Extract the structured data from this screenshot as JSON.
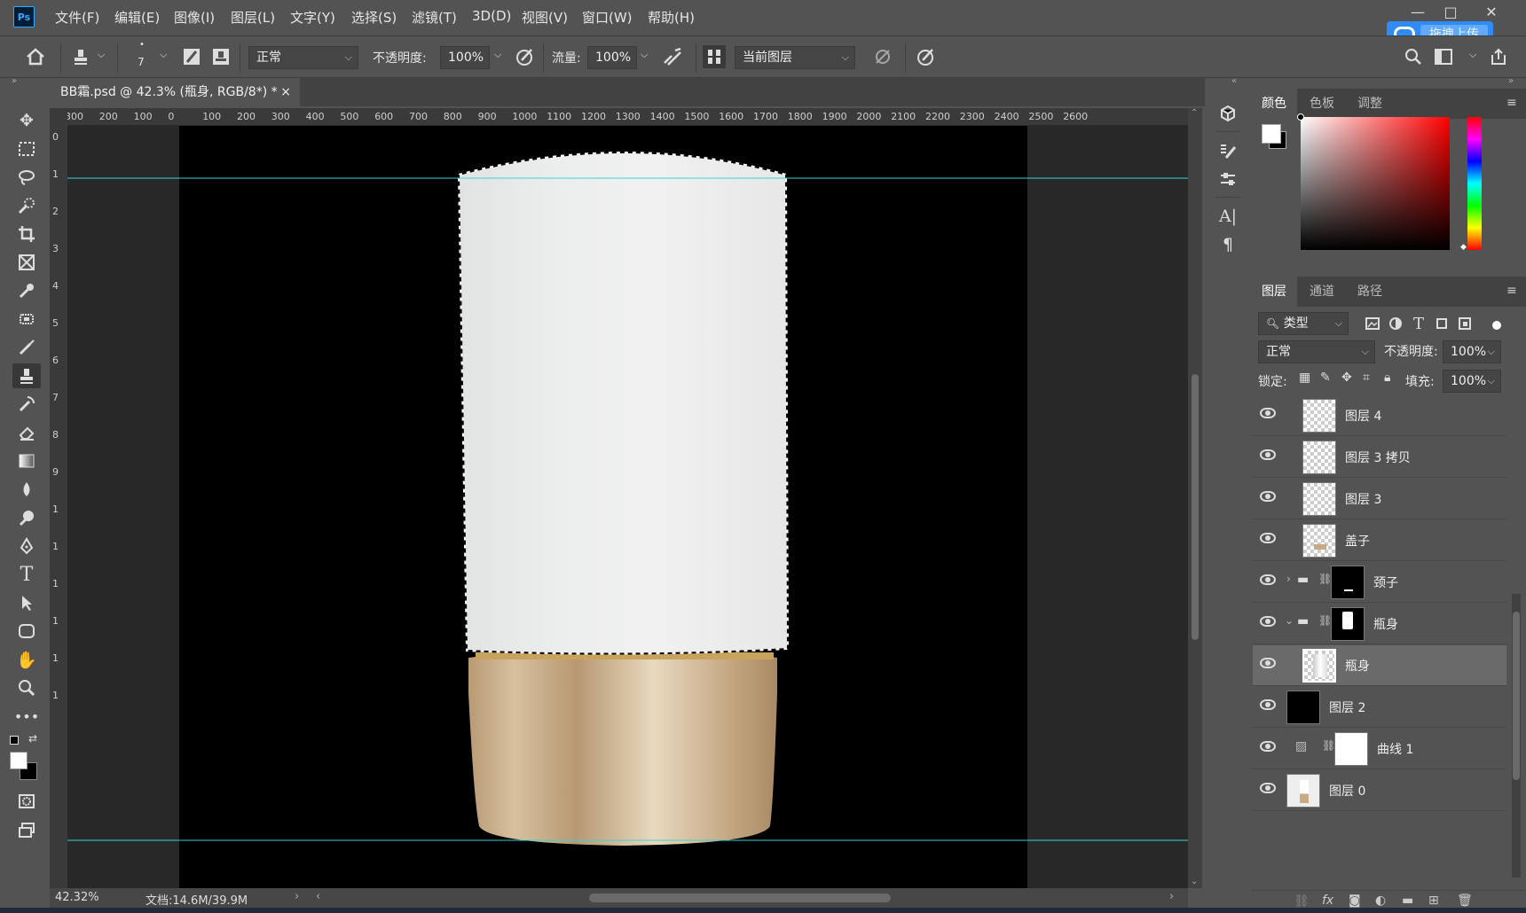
{
  "app": {
    "logo": "Ps",
    "upload_label": "拖拽上传"
  },
  "menu": [
    "文件(F)",
    "编辑(E)",
    "图像(I)",
    "图层(L)",
    "文字(Y)",
    "选择(S)",
    "滤镜(T)",
    "3D(D)",
    "视图(V)",
    "窗口(W)",
    "帮助(H)"
  ],
  "window_controls": {
    "minimize": "—",
    "maximize": "□",
    "close": "✕"
  },
  "options": {
    "brush_size": "7",
    "mode": "正常",
    "opacity_label": "不透明度:",
    "opacity_value": "100%",
    "flow_label": "流量:",
    "flow_value": "100%",
    "sample": "当前图层"
  },
  "document": {
    "tab_title": "BB霜.psd @ 42.3% (瓶身, RGB/8*) *",
    "close": "×",
    "zoom": "42.32%",
    "doc_info": "文档:14.6M/39.9M"
  },
  "ruler_h": [
    "300",
    "200",
    "100",
    "0",
    "100",
    "200",
    "300",
    "400",
    "500",
    "600",
    "700",
    "800",
    "900",
    "1000",
    "1100",
    "1200",
    "1300",
    "1400",
    "1500",
    "1600",
    "1700",
    "1800",
    "1900",
    "2000",
    "2100",
    "2200",
    "2300",
    "2400",
    "2500",
    "2600"
  ],
  "ruler_v": [
    "0",
    "1",
    "2",
    "3",
    "4",
    "5",
    "6",
    "7",
    "8",
    "9",
    "1",
    "1",
    "1",
    "1",
    "1",
    "1"
  ],
  "color_panel": {
    "tabs": [
      "颜色",
      "色板",
      "调整"
    ]
  },
  "layers_panel": {
    "tabs": [
      "图层",
      "通道",
      "路径"
    ],
    "filter": "类型",
    "blend_mode": "正常",
    "opacity_label": "不透明度:",
    "opacity_value": "100%",
    "lock_label": "锁定:",
    "fill_label": "填充:",
    "fill_value": "100%",
    "layers": [
      {
        "name": "图层 4"
      },
      {
        "name": "图层 3 拷贝"
      },
      {
        "name": "图层 3"
      },
      {
        "name": "盖子"
      },
      {
        "name": "颈子"
      },
      {
        "name": "瓶身"
      },
      {
        "name": "瓶身"
      },
      {
        "name": "图层 2"
      },
      {
        "name": "曲线 1"
      },
      {
        "name": "图层 0"
      }
    ]
  },
  "colors": {
    "accent": "#31a8ff",
    "guide": "#3ad3d3",
    "bottle_gold": "#c8aa85",
    "bottle_white": "#e9eae8"
  }
}
